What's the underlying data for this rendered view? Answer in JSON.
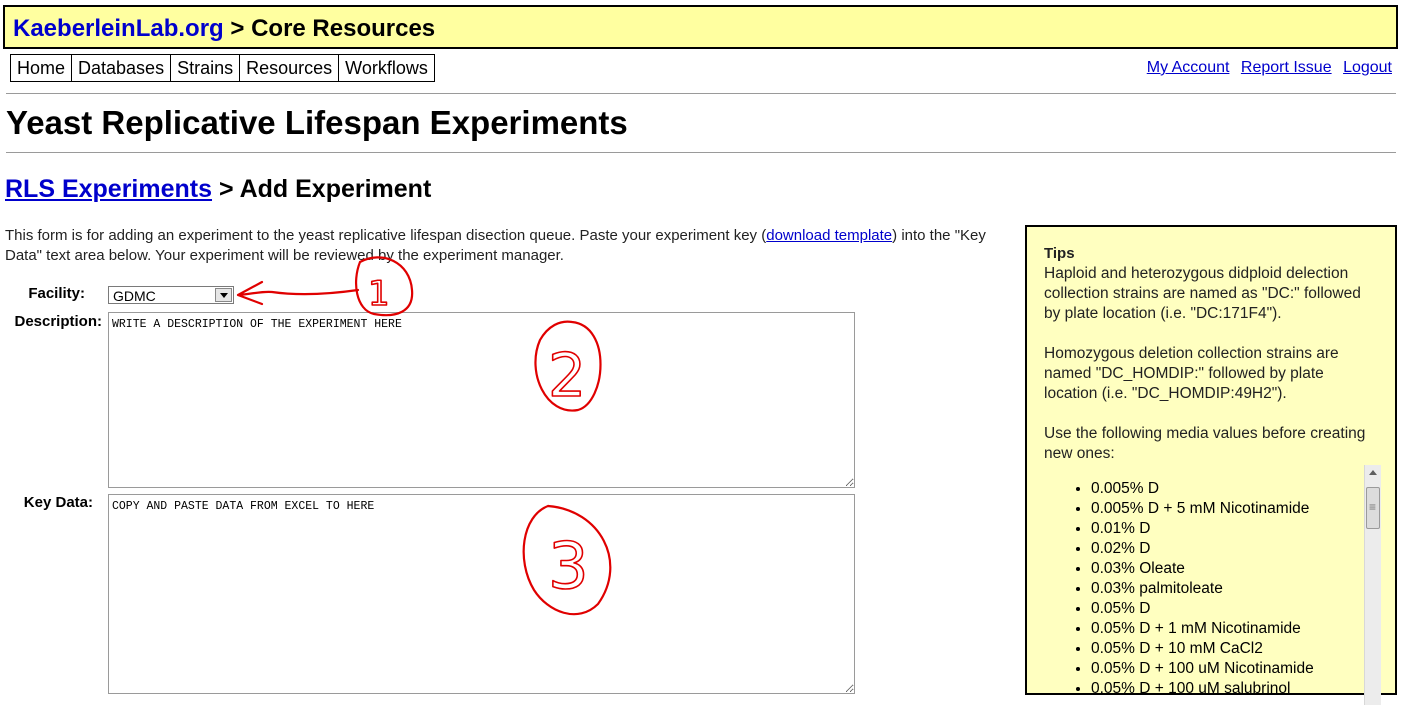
{
  "header": {
    "site_link": "KaeberleinLab.org",
    "separator": " > ",
    "section": "Core Resources"
  },
  "nav": [
    "Home",
    "Databases",
    "Strains",
    "Resources",
    "Workflows"
  ],
  "user_links": [
    "My Account",
    "Report Issue",
    "Logout"
  ],
  "page_title": "Yeast Replicative Lifespan Experiments",
  "breadcrumb": {
    "link": "RLS Experiments",
    "current": " > Add Experiment"
  },
  "intro": {
    "before_link": "This form is for adding an experiment to the yeast replicative lifespan disection queue. Paste your experiment key (",
    "link": "download template",
    "after_link": ") into the \"Key Data\" text area below. Your experiment will be reviewed by the experiment manager."
  },
  "form": {
    "facility_label": "Facility:",
    "facility_value": "GDMC",
    "description_label": "Description:",
    "description_value": "WRITE A DESCRIPTION OF THE EXPERIMENT HERE",
    "keydata_label": "Key Data:",
    "keydata_value": "COPY AND PASTE DATA FROM EXCEL TO HERE"
  },
  "tips": {
    "title": "Tips",
    "p1": "Haploid and heterozygous didploid delection collection strains are named as \"DC:\" followed by plate location (i.e. \"DC:171F4\").",
    "p2": "Homozygous deletion collection strains are named \"DC_HOMDIP:\" followed by plate location (i.e. \"DC_HOMDIP:49H2\").",
    "p3": "Use the following media values before creating new ones:",
    "media": [
      "0.005% D",
      "0.005% D + 5 mM Nicotinamide",
      "0.01% D",
      "0.02% D",
      "0.03% Oleate",
      "0.03% palmitoleate",
      "0.05% D",
      "0.05% D + 1 mM Nicotinamide",
      "0.05% D + 10 mM CaCl2",
      "0.05% D + 100 uM Nicotinamide",
      "0.05% D + 100 uM salubrinol"
    ]
  },
  "annotations": [
    "1",
    "2",
    "3"
  ],
  "colors": {
    "header_bg": "#ffffa0",
    "tips_bg": "#ffffc0",
    "link": "#0000cc",
    "annotation": "#e00000"
  }
}
